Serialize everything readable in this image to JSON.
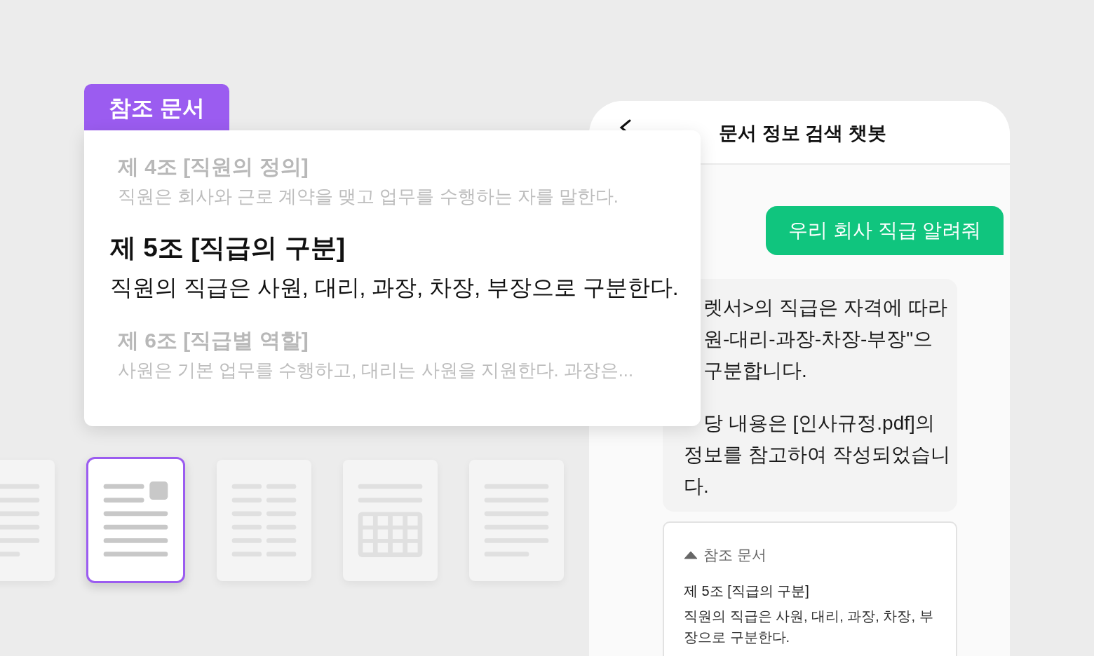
{
  "reference_tag": "참조 문서",
  "reference_items": [
    {
      "title": "제 4조 [직원의 정의]",
      "text": "직원은 회사와 근로 계약을 맺고 업무를 수행하는 자를 말한다.",
      "selected": false
    },
    {
      "title": "제 5조 [직급의 구분]",
      "text": "직원의 직급은 사원, 대리, 과장, 차장, 부장으로 구분한다.",
      "selected": true
    },
    {
      "title": "제 6조 [직급별 역할]",
      "text": "사원은 기본 업무를 수행하고, 대리는 사원을 지원한다. 과장은...",
      "selected": false
    }
  ],
  "documents": [
    {
      "kind": "text",
      "selected": false
    },
    {
      "kind": "text-image",
      "selected": true
    },
    {
      "kind": "columns",
      "selected": false
    },
    {
      "kind": "table",
      "selected": false
    },
    {
      "kind": "text",
      "selected": false
    }
  ],
  "chat": {
    "title": "문서 정보 검색 챗봇",
    "user_message": "우리 회사 직급 알려줘",
    "bot_paragraphs": [
      [
        {
          "text": "렛서>의 직급은 자격에 따라",
          "partly_covered": true
        },
        {
          "text": "원-대리-과장-차장-부장\"으",
          "partly_covered": true
        },
        {
          "text": "구분합니다.",
          "partly_covered": true
        }
      ],
      [
        {
          "text": "당 내용은 [인사규정.pdf]의",
          "partly_covered": true
        },
        {
          "text": "정보를 참고하여 작성되었습니",
          "partly_covered": false
        },
        {
          "text": "다.",
          "partly_covered": false
        }
      ]
    ],
    "reference_card": {
      "label": "참조 문서",
      "expanded": true,
      "title": "제 5조 [직급의 구분]",
      "text": "직원의 직급은 사원, 대리, 과장, 차장, 부장으로 구분한다."
    }
  }
}
